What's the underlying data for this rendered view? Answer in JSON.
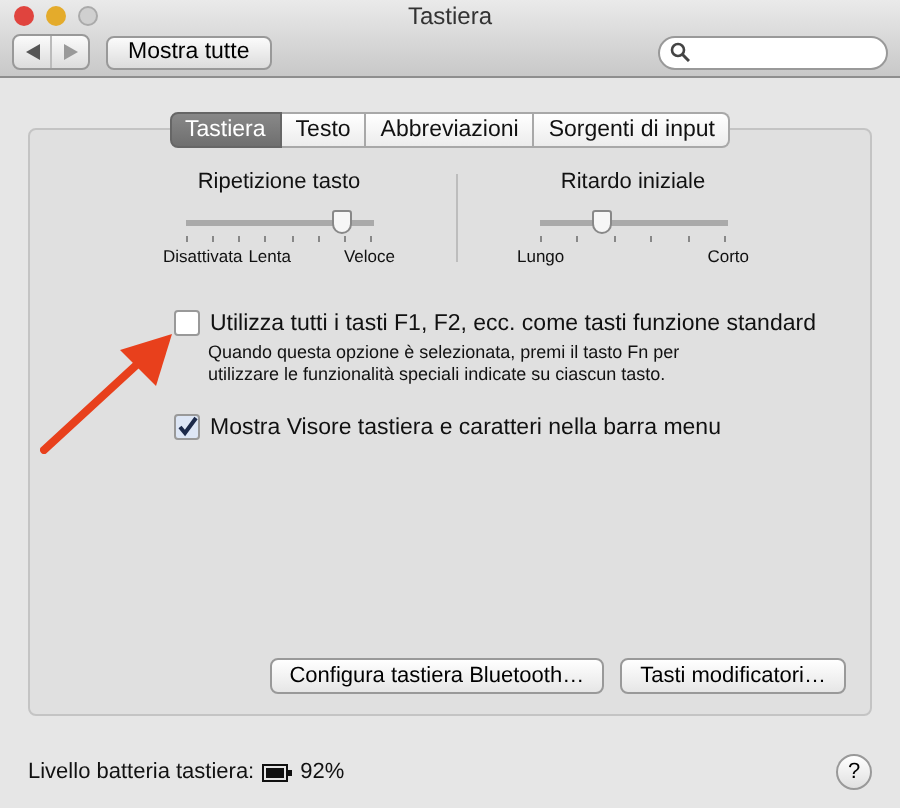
{
  "window": {
    "title": "Tastiera"
  },
  "toolbar": {
    "show_all": "Mostra tutte"
  },
  "tabs": [
    {
      "label": "Tastiera",
      "selected": true
    },
    {
      "label": "Testo",
      "selected": false
    },
    {
      "label": "Abbreviazioni",
      "selected": false
    },
    {
      "label": "Sorgenti di input",
      "selected": false
    }
  ],
  "sliders": [
    {
      "title": "Ripetizione tasto",
      "level": 0.83,
      "min_labels": [
        "Disattivata",
        "Lenta"
      ],
      "max_label": "Veloce"
    },
    {
      "title": "Ritardo iniziale",
      "level": 0.33,
      "min_labels": [
        "Lungo"
      ],
      "max_label": "Corto"
    }
  ],
  "options": [
    {
      "label": "Utilizza tutti i tasti F1, F2, ecc. come tasti funzione standard",
      "checked": false,
      "description": "Quando questa opzione è selezionata, premi il tasto Fn per utilizzare le funzionalità speciali indicate su ciascun tasto."
    },
    {
      "label": "Mostra Visore tastiera e caratteri nella barra menu",
      "checked": true
    }
  ],
  "buttons": [
    "Configura tastiera Bluetooth…",
    "Tasti modificatori…"
  ],
  "status": {
    "label": "Livello batteria tastiera:",
    "battery": "92%",
    "help": "?"
  }
}
